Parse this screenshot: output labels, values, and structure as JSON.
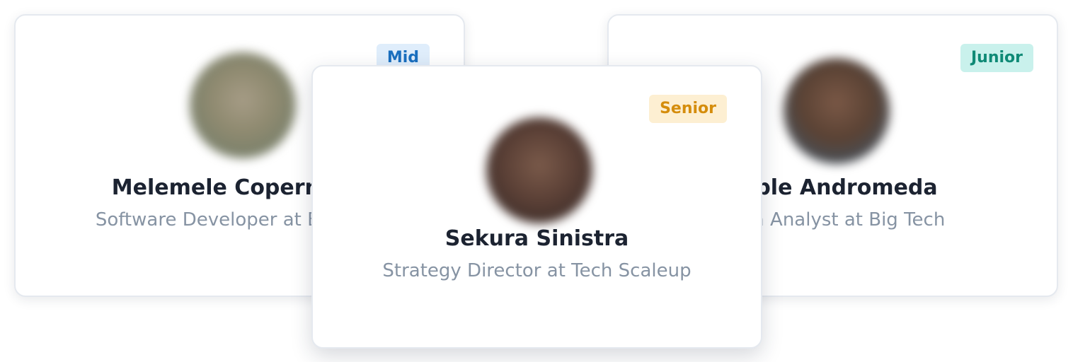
{
  "cards": [
    {
      "name": "Melemele Copernicus",
      "role": "Software Developer at Big Tech",
      "badge": "Mid"
    },
    {
      "name": "Sekura Sinistra",
      "role": "Strategy Director at Tech Scaleup",
      "badge": "Senior"
    },
    {
      "name": "Fable Andromeda",
      "role": "Data Analyst at Big Tech",
      "badge": "Junior"
    }
  ],
  "colors": {
    "mid_badge_bg": "#dfedfb",
    "mid_badge_text": "#1a6fbf",
    "senior_badge_bg": "#fdefd2",
    "senior_badge_text": "#d58d0c",
    "junior_badge_bg": "#c9f1ec",
    "junior_badge_text": "#0f8a76",
    "name_text": "#1c2331",
    "role_text": "#8693a3"
  }
}
